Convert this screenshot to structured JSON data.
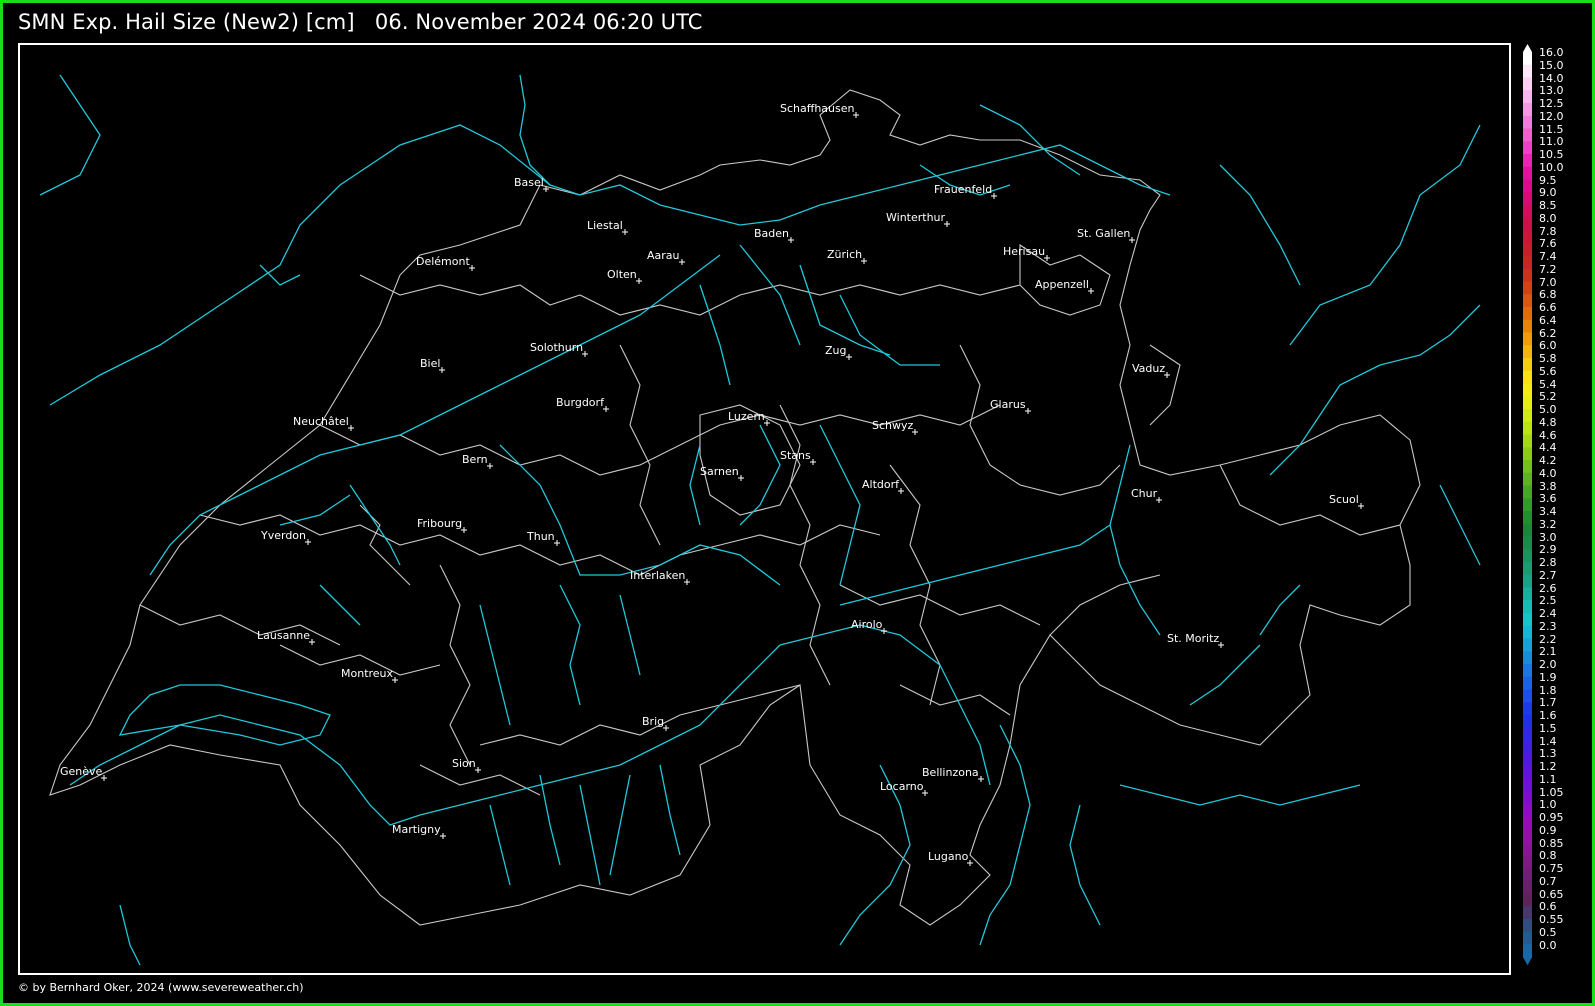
{
  "title": "SMN Exp. Hail Size (New2) [cm]   06. November 2024 06:20 UTC",
  "credit": "© by Bernhard Oker, 2024 (www.severeweather.ch)",
  "colors": {
    "frame": "#18e018",
    "rivers": "#22c8d8",
    "borders": "#c8c8c8",
    "text": "#ffffff"
  },
  "cities": [
    {
      "id": "schaffhausen",
      "name": "Schaffhausen"
    },
    {
      "id": "basel",
      "name": "Basel"
    },
    {
      "id": "liestal",
      "name": "Liestal"
    },
    {
      "id": "frauenfeld",
      "name": "Frauenfeld"
    },
    {
      "id": "winterthur",
      "name": "Winterthur"
    },
    {
      "id": "baden",
      "name": "Baden"
    },
    {
      "id": "st-gallen",
      "name": "St. Gallen"
    },
    {
      "id": "herisau",
      "name": "Herisau"
    },
    {
      "id": "delemont",
      "name": "Delémont"
    },
    {
      "id": "aarau",
      "name": "Aarau"
    },
    {
      "id": "zurich",
      "name": "Zürich"
    },
    {
      "id": "olten",
      "name": "Olten"
    },
    {
      "id": "appenzell",
      "name": "Appenzell"
    },
    {
      "id": "solothurn",
      "name": "Solothurn"
    },
    {
      "id": "zug",
      "name": "Zug"
    },
    {
      "id": "biel",
      "name": "Biel"
    },
    {
      "id": "vaduz",
      "name": "Vaduz"
    },
    {
      "id": "burgdorf",
      "name": "Burgdorf"
    },
    {
      "id": "glarus",
      "name": "Glarus"
    },
    {
      "id": "luzern",
      "name": "Luzern"
    },
    {
      "id": "neuchatel",
      "name": "Neuchâtel"
    },
    {
      "id": "schwyz",
      "name": "Schwyz"
    },
    {
      "id": "bern",
      "name": "Bern"
    },
    {
      "id": "stans",
      "name": "Stans"
    },
    {
      "id": "sarnen",
      "name": "Sarnen"
    },
    {
      "id": "altdorf",
      "name": "Altdorf"
    },
    {
      "id": "chur",
      "name": "Chur"
    },
    {
      "id": "scuol",
      "name": "Scuol"
    },
    {
      "id": "fribourg",
      "name": "Fribourg"
    },
    {
      "id": "yverdon",
      "name": "Yverdon"
    },
    {
      "id": "thun",
      "name": "Thun"
    },
    {
      "id": "interlaken",
      "name": "Interlaken"
    },
    {
      "id": "airolo",
      "name": "Airolo"
    },
    {
      "id": "lausanne",
      "name": "Lausanne"
    },
    {
      "id": "st-moritz",
      "name": "St. Moritz"
    },
    {
      "id": "montreux",
      "name": "Montreux"
    },
    {
      "id": "brig",
      "name": "Brig"
    },
    {
      "id": "geneve",
      "name": "Genève"
    },
    {
      "id": "sion",
      "name": "Sion"
    },
    {
      "id": "bellinzona",
      "name": "Bellinzona"
    },
    {
      "id": "locarno",
      "name": "Locarno"
    },
    {
      "id": "martigny",
      "name": "Martigny"
    },
    {
      "id": "lugano",
      "name": "Lugano"
    }
  ],
  "legend": {
    "labels": [
      "16.0",
      "15.0",
      "14.0",
      "13.0",
      "12.5",
      "12.0",
      "11.5",
      "11.0",
      "10.5",
      "10.0",
      "9.5",
      "9.0",
      "8.5",
      "8.0",
      "7.8",
      "7.6",
      "7.4",
      "7.2",
      "7.0",
      "6.8",
      "6.6",
      "6.4",
      "6.2",
      "6.0",
      "5.8",
      "5.6",
      "5.4",
      "5.2",
      "5.0",
      "4.8",
      "4.6",
      "4.4",
      "4.2",
      "4.0",
      "3.8",
      "3.6",
      "3.4",
      "3.2",
      "3.0",
      "2.9",
      "2.8",
      "2.7",
      "2.6",
      "2.5",
      "2.4",
      "2.3",
      "2.2",
      "2.1",
      "2.0",
      "1.9",
      "1.8",
      "1.7",
      "1.6",
      "1.5",
      "1.4",
      "1.3",
      "1.2",
      "1.1",
      "1.05",
      "1.0",
      "0.95",
      "0.9",
      "0.85",
      "0.8",
      "0.75",
      "0.7",
      "0.65",
      "0.6",
      "0.55",
      "0.5",
      "0.0"
    ],
    "colors": [
      "#ffffff",
      "#fde8f8",
      "#fbd0f2",
      "#f8b4ec",
      "#f598e4",
      "#f27cdc",
      "#ef5ed2",
      "#ec40c8",
      "#e824b8",
      "#e410a4",
      "#e0088c",
      "#dc0874",
      "#d40c5c",
      "#cc1048",
      "#c81838",
      "#c4202c",
      "#c42820",
      "#c83418",
      "#d04414",
      "#d85810",
      "#e06c0c",
      "#e8840c",
      "#f09c0c",
      "#f4b40c",
      "#f8cc0c",
      "#fce010",
      "#f4ec10",
      "#e4f010",
      "#d0ec10",
      "#bce410",
      "#a4d814",
      "#8ccc18",
      "#74c01c",
      "#5cb420",
      "#44a824",
      "#309c28",
      "#20902c",
      "#188838",
      "#188c48",
      "#18945c",
      "#189c70",
      "#18a484",
      "#18b09c",
      "#18bcb4",
      "#18c4c8",
      "#18b4d4",
      "#18a0d8",
      "#188cdc",
      "#1878e0",
      "#1864e4",
      "#1850e8",
      "#183ce8",
      "#2030e8",
      "#3028e4",
      "#4020e0",
      "#5018dc",
      "#6014d8",
      "#7010d4",
      "#800ccc",
      "#900cc4",
      "#980cb8",
      "#9410a8",
      "#8c1498",
      "#801888",
      "#741c78",
      "#682068",
      "#5c2458",
      "#48386c",
      "#304c80",
      "#205c94",
      "#1868a8"
    ]
  }
}
